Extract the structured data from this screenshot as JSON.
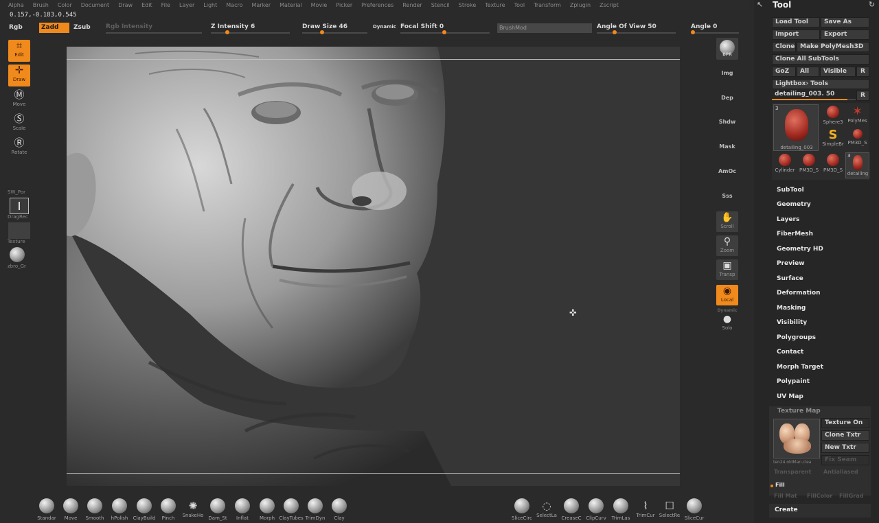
{
  "menu": [
    "Alpha",
    "Brush",
    "Color",
    "Document",
    "Draw",
    "Edit",
    "File",
    "Layer",
    "Light",
    "Macro",
    "Marker",
    "Material",
    "Movie",
    "Picker",
    "Preferences",
    "Render",
    "Stencil",
    "Stroke",
    "Texture",
    "Tool",
    "Transform",
    "Zplugin",
    "Zscript"
  ],
  "coords": "0.157,-0.183,0.545",
  "toolbar": {
    "rgb": "Rgb",
    "zadd": "Zadd",
    "zsub": "Zsub",
    "rgb_intensity": "Rgb Intensity",
    "z_intensity": "Z Intensity 6",
    "draw_size": "Draw Size 46",
    "dynamic": "Dynamic",
    "focal_shift": "Focal Shift 0",
    "brushmod": "BrushMod",
    "angle_of_view": "Angle Of View 50",
    "angle": "Angle 0"
  },
  "left_shelf": {
    "edit": "Edit",
    "draw": "Draw",
    "move": "Move",
    "scale": "Scale",
    "rotate": "Rotate",
    "brush_label": "SW_Por",
    "stroke_label": "DragRec",
    "texture_label": "Texture",
    "material_label": "zbro_Gr"
  },
  "right_shelf": {
    "bpr": "BPR",
    "img": "Img",
    "dep": "Dep",
    "shdw": "Shdw",
    "mask": "Mask",
    "amoc": "AmOc",
    "sss": "Sss",
    "scroll": "Scroll",
    "zoom": "Zoom",
    "transp": "Transp",
    "local": "Local",
    "dynamic": "Dynamic",
    "solo": "Solo"
  },
  "tool_panel": {
    "title": "Tool",
    "load_tool": "Load Tool",
    "save_as": "Save As",
    "import": "Import",
    "export": "Export",
    "clone": "Clone",
    "make_polymesh": "Make PolyMesh3D",
    "clone_all": "Clone All SubTools",
    "goz": "GoZ",
    "all": "All",
    "visible": "Visible",
    "r": "R",
    "lightbox_tools": "Lightbox› Tools",
    "current_tool": "detailing_003. 50",
    "thumbs": [
      {
        "label": "detailing_003",
        "count": "3"
      },
      {
        "label": "Sphere3"
      },
      {
        "label": "PolyMes"
      },
      {
        "label": "SimpleBr"
      },
      {
        "label": "PM3D_S"
      },
      {
        "label": "Cylinder"
      },
      {
        "label": "PM3D_S"
      },
      {
        "label": "PM3D_S"
      },
      {
        "label": "detailing",
        "count": "3"
      }
    ],
    "sections": [
      "SubTool",
      "Geometry",
      "Layers",
      "FiberMesh",
      "Geometry HD",
      "Preview",
      "Surface",
      "Deformation",
      "Masking",
      "Visibility",
      "Polygroups",
      "Contact",
      "Morph Target",
      "Polypaint",
      "UV Map"
    ],
    "texture_map": {
      "title": "Texture Map",
      "texture_on": "Texture On",
      "clone_txtr": "Clone Txtr",
      "new_txtr": "New Txtr",
      "fix_seam": "Fix Seam",
      "thumb_label": "ten24.oldMan.clea",
      "transparent": "Transparent",
      "antialiased": "Antialiased"
    },
    "fill": "Fill",
    "fill_mat": "Fill Mat",
    "fill_color": "FillColor",
    "fill_grad": "FillGrad",
    "create": "Create"
  },
  "brushes": [
    "Standar",
    "Move",
    "Smooth",
    "hPolish",
    "ClayBuild",
    "Pinch",
    "SnakeHo",
    "Dam_St",
    "Inflat",
    "Morph",
    "ClayTubes",
    "TrimDyn",
    "Clay"
  ],
  "brushes_right": [
    "SliceCirc",
    "SelectLa",
    "CreaseC",
    "ClipCurv",
    "TrimLas",
    "TrimCur",
    "SelectRe",
    "SliceCur"
  ]
}
